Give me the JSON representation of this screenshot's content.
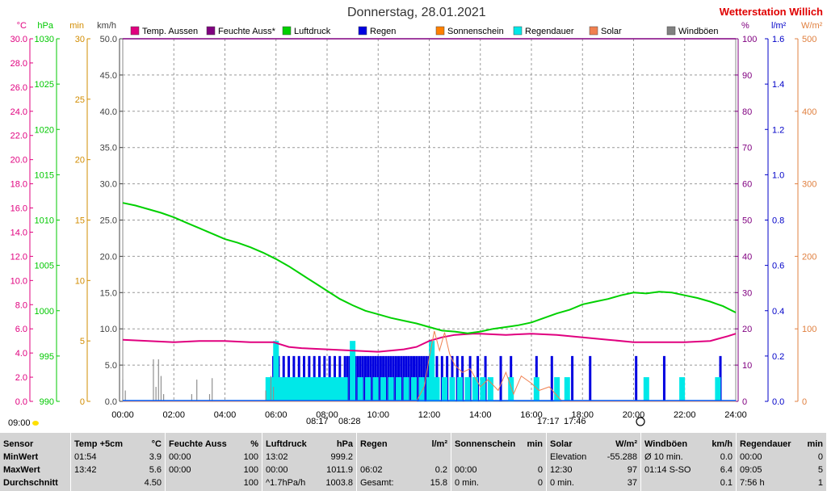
{
  "header": {
    "title": "Donnerstag, 28.01.2021",
    "station": "Wetterstation Willich"
  },
  "axes": {
    "left": [
      {
        "unit": "°C",
        "color": "#e0007f",
        "min": 0,
        "max": 30,
        "step": 2,
        "decimals": 1
      },
      {
        "unit": "hPa",
        "color": "#00c800",
        "min": 990,
        "max": 1030,
        "step": 5,
        "decimals": 0
      },
      {
        "unit": "min",
        "color": "#d28c00",
        "min": 0,
        "max": 30,
        "step": 5,
        "decimals": 0
      },
      {
        "unit": "km/h",
        "color": "#404040",
        "min": 0,
        "max": 50,
        "step": 5,
        "decimals": 1
      }
    ],
    "right": [
      {
        "unit": "%",
        "color": "#800080",
        "min": 0,
        "max": 100,
        "step": 10,
        "decimals": 0
      },
      {
        "unit": "l/m²",
        "color": "#0000c8",
        "min": 0,
        "max": 1.6,
        "step": 0.2,
        "decimals": 1
      },
      {
        "unit": "W/m²",
        "color": "#e08040",
        "min": 0,
        "max": 500,
        "step": 100,
        "decimals": 0
      }
    ]
  },
  "legend": [
    {
      "label": "Temp. Aussen",
      "color": "#e0007f"
    },
    {
      "label": "Feuchte Auss*",
      "color": "#800080"
    },
    {
      "label": "Luftdruck",
      "color": "#00d000"
    },
    {
      "label": "Regen",
      "color": "#0000e0"
    },
    {
      "label": "Sonnenschein",
      "color": "#ff8000"
    },
    {
      "label": "Regendauer",
      "color": "#00e8e8"
    },
    {
      "label": "Solar",
      "color": "#f08050"
    },
    {
      "label": "Windböen",
      "color": "#808080"
    }
  ],
  "chart_data": {
    "type": "line",
    "x_ticks": [
      "00:00",
      "02:00",
      "04:00",
      "06:00",
      "08:00",
      "10:00",
      "12:00",
      "14:00",
      "16:00",
      "18:00",
      "20:00",
      "22:00",
      "24:00"
    ],
    "x_range": [
      0,
      24
    ],
    "grid": true,
    "series": [
      {
        "name": "Temp. Aussen",
        "axis": "°C",
        "color": "#e0007f",
        "x": [
          0,
          1,
          2,
          3,
          4,
          5,
          5.9,
          6.5,
          7,
          8,
          9,
          10,
          11,
          11.5,
          12,
          12.5,
          13,
          13.7,
          14,
          15,
          16,
          17,
          18,
          19,
          20,
          21,
          22,
          23,
          23.7,
          24
        ],
        "y": [
          5.1,
          5.0,
          4.9,
          5.0,
          5.0,
          4.9,
          4.9,
          4.5,
          4.4,
          4.3,
          4.2,
          4.1,
          4.3,
          4.5,
          5.0,
          5.3,
          5.5,
          5.6,
          5.6,
          5.5,
          5.6,
          5.5,
          5.3,
          5.1,
          4.9,
          4.9,
          4.9,
          5.0,
          5.4,
          5.6
        ]
      },
      {
        "name": "Luftdruck",
        "axis": "hPa",
        "color": "#00d000",
        "x": [
          0,
          0.5,
          1,
          1.5,
          2,
          2.5,
          3,
          3.5,
          4,
          4.5,
          5,
          5.5,
          6,
          6.5,
          7,
          7.5,
          8,
          8.5,
          9,
          9.5,
          10,
          10.5,
          11,
          11.5,
          12,
          12.5,
          13,
          13.5,
          14,
          14.5,
          15,
          15.5,
          16,
          16.5,
          17,
          17.5,
          18,
          18.5,
          19,
          19.5,
          20,
          20.5,
          21,
          21.5,
          22,
          22.5,
          23,
          23.5,
          24
        ],
        "y": [
          1011.9,
          1011.6,
          1011.2,
          1010.8,
          1010.3,
          1009.7,
          1009.1,
          1008.5,
          1007.9,
          1007.5,
          1007.0,
          1006.4,
          1005.7,
          1004.9,
          1004.0,
          1003.1,
          1002.2,
          1001.3,
          1000.6,
          1000.0,
          999.6,
          999.2,
          998.9,
          998.6,
          998.2,
          997.8,
          997.7,
          997.5,
          997.7,
          998.0,
          998.2,
          998.4,
          998.7,
          999.2,
          999.7,
          1000.1,
          1000.7,
          1001.0,
          1001.3,
          1001.7,
          1002.0,
          1001.9,
          1002.1,
          1002.0,
          1001.7,
          1001.4,
          1001.0,
          1000.5,
          999.8
        ]
      },
      {
        "name": "Solar",
        "axis": "W/m²",
        "color": "#f08050",
        "x": [
          0,
          11.5,
          11.8,
          12.0,
          12.2,
          12.4,
          12.6,
          12.8,
          13.0,
          13.3,
          13.6,
          14.0,
          14.3,
          14.7,
          15.0,
          15.3,
          15.6,
          16.0,
          16.3,
          16.7,
          17.0,
          17.2,
          24
        ],
        "y": [
          0,
          0,
          20,
          60,
          97,
          70,
          95,
          65,
          50,
          40,
          45,
          20,
          30,
          15,
          40,
          10,
          35,
          25,
          15,
          20,
          8,
          0,
          0
        ]
      }
    ],
    "bars": [
      {
        "name": "Regen",
        "axis": "l/m²",
        "color": "#0000e0",
        "x": [
          5.9,
          6.1,
          6.3,
          6.5,
          6.7,
          6.9,
          7.1,
          7.3,
          7.5,
          7.7,
          7.9,
          8.1,
          8.3,
          8.5,
          8.7,
          8.8,
          8.9,
          9.0,
          9.1,
          9.2,
          9.3,
          9.4,
          9.5,
          9.6,
          9.7,
          9.8,
          9.9,
          10.0,
          10.1,
          10.2,
          10.3,
          10.4,
          10.5,
          10.6,
          10.7,
          10.8,
          10.9,
          11.0,
          11.1,
          11.2,
          11.3,
          11.4,
          11.5,
          11.6,
          11.7,
          11.8,
          11.9,
          12.0,
          12.1,
          12.3,
          12.5,
          12.7,
          12.9,
          13.1,
          13.3,
          13.6,
          13.9,
          14.2,
          14.8,
          15.2,
          16.2,
          16.8,
          17.6,
          18.3,
          20.1,
          21.2,
          23.4
        ],
        "y": [
          0.2,
          0.2,
          0.2,
          0.2,
          0.2,
          0.2,
          0.2,
          0.2,
          0.2,
          0.2,
          0.2,
          0.2,
          0.2,
          0.2,
          0.2,
          0.2,
          0.2,
          0.2,
          0.2,
          0.2,
          0.2,
          0.2,
          0.2,
          0.2,
          0.2,
          0.2,
          0.2,
          0.2,
          0.2,
          0.2,
          0.2,
          0.2,
          0.2,
          0.2,
          0.2,
          0.2,
          0.2,
          0.2,
          0.2,
          0.2,
          0.2,
          0.2,
          0.2,
          0.2,
          0.2,
          0.2,
          0.2,
          0.2,
          0.2,
          0.2,
          0.2,
          0.2,
          0.2,
          0.2,
          0.2,
          0.2,
          0.2,
          0.2,
          0.2,
          0.2,
          0.2,
          0.2,
          0.2,
          0.2,
          0.2,
          0.2,
          0.2
        ]
      },
      {
        "name": "Regendauer",
        "axis": "min",
        "color": "#00e8e8",
        "x": [
          5.7,
          5.9,
          6.0,
          6.1,
          6.3,
          6.5,
          6.7,
          6.9,
          7.1,
          7.3,
          7.5,
          7.7,
          7.9,
          8.1,
          8.3,
          8.5,
          8.7,
          9.0,
          9.3,
          9.6,
          9.9,
          10.2,
          10.5,
          10.8,
          11.1,
          11.4,
          11.7,
          12.0,
          12.1,
          12.3,
          12.6,
          12.9,
          13.2,
          13.5,
          13.8,
          14.1,
          14.4,
          15.2,
          16.2,
          17.0,
          17.4,
          20.5,
          21.9,
          23.3
        ],
        "y": [
          2,
          2,
          5,
          2,
          2,
          2,
          2,
          2,
          2,
          2,
          2,
          2,
          2,
          2,
          2,
          2,
          2,
          5,
          2,
          2,
          2,
          2,
          2,
          2,
          2,
          2,
          2,
          2,
          5,
          2,
          2,
          2,
          2,
          2,
          2,
          2,
          2,
          2,
          2,
          2,
          2,
          2,
          2,
          2
        ]
      },
      {
        "name": "Windböen",
        "axis": "km/h",
        "color": "#909090",
        "x": [
          0.0,
          0.1,
          1.2,
          1.3,
          1.4,
          1.5,
          1.6,
          2.7,
          2.9,
          3.4,
          3.5,
          5.6,
          5.8,
          5.9
        ],
        "y": [
          3.0,
          1.5,
          5.8,
          2.0,
          5.8,
          3.5,
          1.0,
          1.0,
          3.0,
          1.0,
          3.2,
          1.5,
          3.5,
          2.0
        ]
      }
    ],
    "markers": [
      {
        "label": "09:00",
        "time": "09:00"
      },
      {
        "label": "08:17",
        "time": "08:17"
      },
      {
        "label": "08:28",
        "time": "08:28"
      },
      {
        "label": "17:17",
        "time": "17:17"
      },
      {
        "label": "17:46",
        "time": "17:46"
      }
    ]
  },
  "stats": {
    "row_labels": [
      "Sensor",
      "MinWert",
      "MaxWert",
      "Durchschnitt"
    ],
    "columns": [
      {
        "title": "Temp +5cm",
        "unit": "°C",
        "rows": [
          [
            "01:54",
            "3.9"
          ],
          [
            "13:42",
            "5.6"
          ],
          [
            "",
            "4.50"
          ]
        ]
      },
      {
        "title": "Feuchte Auss",
        "unit": "%",
        "rows": [
          [
            "00:00",
            "100"
          ],
          [
            "00:00",
            "100"
          ],
          [
            "",
            "100"
          ]
        ]
      },
      {
        "title": "Luftdruck",
        "unit": "hPa",
        "rows": [
          [
            "13:02",
            "999.2"
          ],
          [
            "00:00",
            "1011.9"
          ],
          [
            "^1.7hPa/h",
            "1003.8"
          ]
        ]
      },
      {
        "title": "Regen",
        "unit": "l/m²",
        "rows": [
          [
            "",
            ""
          ],
          [
            "06:02",
            "0.2"
          ],
          [
            "Gesamt:",
            "15.8"
          ]
        ]
      },
      {
        "title": "Sonnenschein",
        "unit": "min",
        "rows": [
          [
            "",
            ""
          ],
          [
            "00:00",
            "0"
          ],
          [
            "0 min.",
            "0"
          ]
        ]
      },
      {
        "title": "Solar",
        "unit": "W/m²",
        "rows": [
          [
            "Elevation",
            "-55.288"
          ],
          [
            "12:30",
            "97"
          ],
          [
            "0 min.",
            "37"
          ]
        ]
      },
      {
        "title": "Windböen",
        "unit": "km/h",
        "rows": [
          [
            "Ø 10 min.",
            "0.0"
          ],
          [
            "01:14 S-SO",
            "6.4"
          ],
          [
            "",
            "0.1"
          ]
        ]
      },
      {
        "title": "Regendauer",
        "unit": "min",
        "rows": [
          [
            "00:00",
            "0"
          ],
          [
            "09:05",
            "5"
          ],
          [
            "7:56 h",
            "1"
          ]
        ]
      }
    ]
  }
}
